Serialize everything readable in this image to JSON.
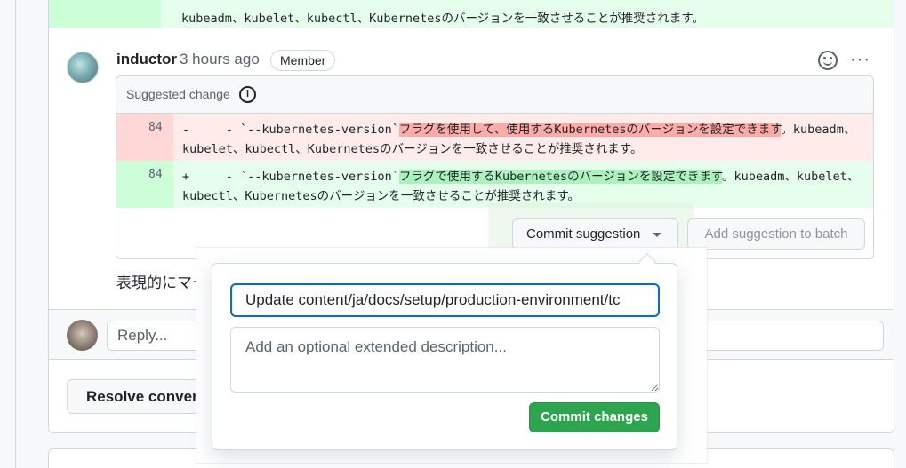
{
  "top_diff": {
    "text": "kubeadm、kubelet、kubectl、Kubernetesのバージョンを一致させることが推奨されます。"
  },
  "comment": {
    "author": "inductor",
    "time": "3 hours ago",
    "badge": "Member",
    "suggested_change_label": "Suggested change",
    "info_icon_glyph": "i",
    "kebab_glyph": "···",
    "deleted": {
      "line_number": "84",
      "sign": "-",
      "pre": "     - `--kubernetes-version`",
      "highlight": "フラグを使用して、使用するKubernetesのバージョンを設定できます",
      "post": "。kubeadm、kubelet、kubectl、Kubernetesのバージョンを一致させることが推奨されます。"
    },
    "added": {
      "line_number": "84",
      "sign": "+",
      "pre": "     - `--kubernetes-version`",
      "highlight": "フラグで使用するKubernetesのバージョンを設定できます",
      "post": "。kubeadm、kubelet、kubectl、Kubernetesのバージョンを一致させることが推奨されます。"
    },
    "commit_suggestion_label": "Commit suggestion",
    "add_to_batch_label": "Add suggestion to batch",
    "body": "表現的にマー"
  },
  "reply": {
    "placeholder": "Reply..."
  },
  "resolve_label": "Resolve conversat",
  "popover": {
    "title_value": "Update content/ja/docs/setup/production-environment/tc",
    "description_placeholder": "Add an optional extended description...",
    "commit_changes_label": "Commit changes"
  },
  "colors": {
    "accent": "#0969da",
    "commit_green": "#2da44e",
    "deletion_bg": "#ffebe9",
    "addition_bg": "#e6ffec"
  }
}
